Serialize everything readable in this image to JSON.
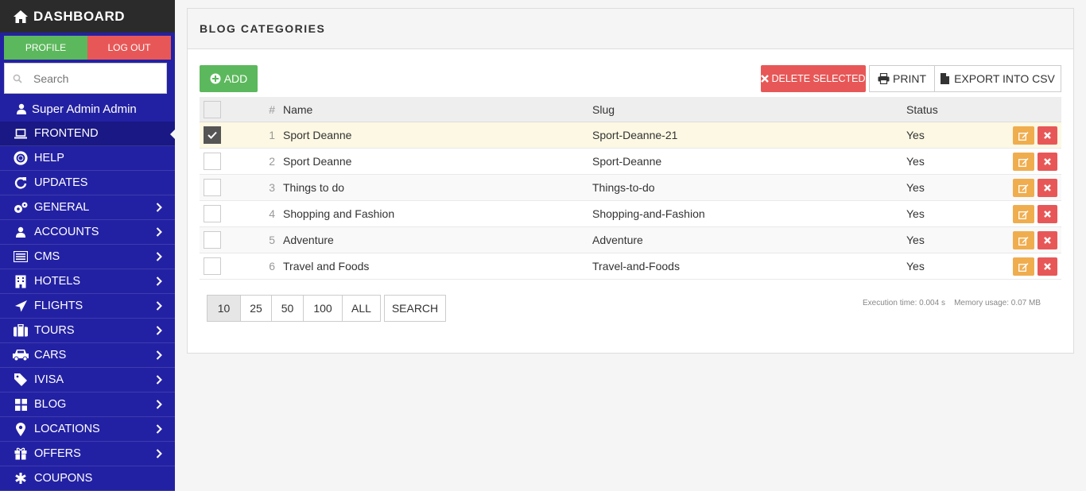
{
  "sidebar": {
    "brand": "DASHBOARD",
    "profile_label": "PROFILE",
    "logout_label": "LOG OUT",
    "search_placeholder": "Search",
    "user_name": "Super Admin Admin",
    "items": [
      {
        "label": "FRONTEND",
        "icon": "laptop-icon",
        "active": true
      },
      {
        "label": "HELP",
        "icon": "lifebuoy-icon"
      },
      {
        "label": "UPDATES",
        "icon": "refresh-icon"
      },
      {
        "label": "GENERAL",
        "icon": "gears-icon",
        "submenu": true
      },
      {
        "label": "ACCOUNTS",
        "icon": "user-icon",
        "submenu": true
      },
      {
        "label": "CMS",
        "icon": "list-icon",
        "submenu": true
      },
      {
        "label": "HOTELS",
        "icon": "building-icon",
        "submenu": true
      },
      {
        "label": "FLIGHTS",
        "icon": "plane-icon",
        "submenu": true
      },
      {
        "label": "TOURS",
        "icon": "suitcase-icon",
        "submenu": true
      },
      {
        "label": "CARS",
        "icon": "car-icon",
        "submenu": true
      },
      {
        "label": "IVISA",
        "icon": "tag-icon",
        "submenu": true
      },
      {
        "label": "BLOG",
        "icon": "grid-icon",
        "submenu": true
      },
      {
        "label": "LOCATIONS",
        "icon": "map-marker-icon",
        "submenu": true
      },
      {
        "label": "OFFERS",
        "icon": "gift-icon",
        "submenu": true
      },
      {
        "label": "COUPONS",
        "icon": "asterisk-icon",
        "submenu": false
      }
    ]
  },
  "panel": {
    "title": "BLOG CATEGORIES",
    "add_label": "ADD",
    "delete_selected_label": "DELETE SELECTED",
    "print_label": "PRINT",
    "export_label": "EXPORT INTO CSV"
  },
  "table": {
    "columns": [
      "#",
      "Name",
      "Slug",
      "Status"
    ],
    "rows": [
      {
        "num": "1",
        "name": "Sport Deanne",
        "slug": "Sport-Deanne-21",
        "status": "Yes",
        "checked": true
      },
      {
        "num": "2",
        "name": "Sport Deanne",
        "slug": "Sport-Deanne",
        "status": "Yes",
        "checked": false
      },
      {
        "num": "3",
        "name": "Things to do",
        "slug": "Things-to-do",
        "status": "Yes",
        "checked": false
      },
      {
        "num": "4",
        "name": "Shopping and Fashion",
        "slug": "Shopping-and-Fashion",
        "status": "Yes",
        "checked": false
      },
      {
        "num": "5",
        "name": "Adventure",
        "slug": "Adventure",
        "status": "Yes",
        "checked": false
      },
      {
        "num": "6",
        "name": "Travel and Foods",
        "slug": "Travel-and-Foods",
        "status": "Yes",
        "checked": false
      }
    ]
  },
  "pager": {
    "sizes": [
      "10",
      "25",
      "50",
      "100",
      "ALL"
    ],
    "active": "10",
    "search_label": "SEARCH"
  },
  "footer": {
    "exec_time": "Execution time: 0.004 s",
    "memory": "Memory usage: 0.07 MB"
  },
  "colors": {
    "sidebar_bg": "#2321a3",
    "brand_bg": "#2b2b2b",
    "success": "#5cb85c",
    "danger": "#e85757",
    "warning": "#f0ad4e",
    "selected_row": "#fcf8e3"
  }
}
